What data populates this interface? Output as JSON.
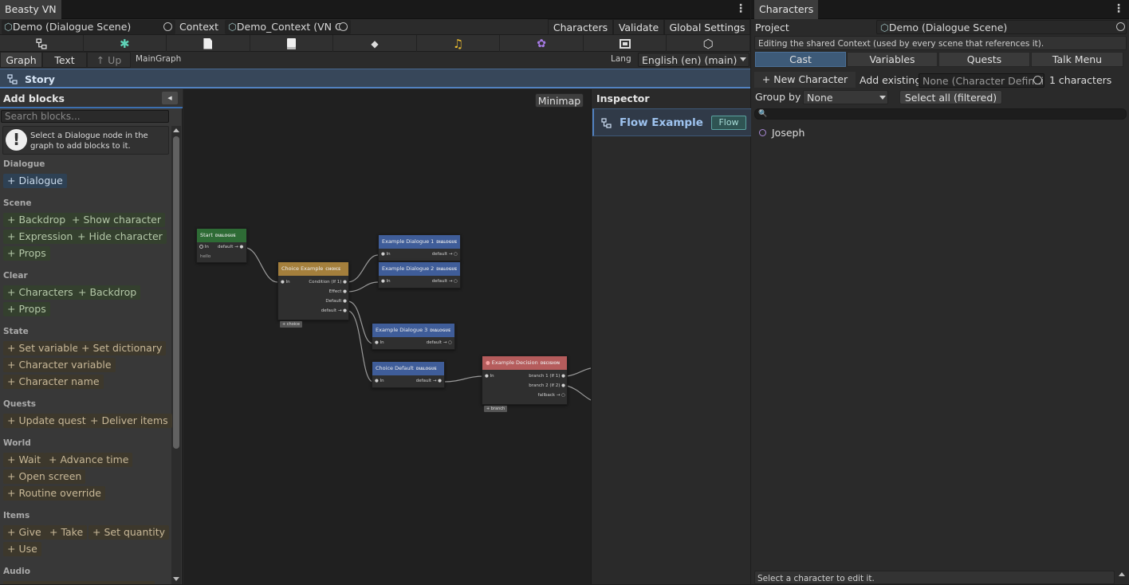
{
  "left_window": {
    "title": "Beasty VN",
    "scene_field": "Demo (Dialogue Scene)",
    "context_label": "Context",
    "context_field": "Demo_Context (VN Co",
    "top_buttons": [
      "Characters",
      "Validate",
      "Global Settings"
    ],
    "toolbar_icons": [
      "graph-icon",
      "character-figure-icon",
      "page-icon",
      "document-icon",
      "tag-icon",
      "music-note-icon",
      "network-icon",
      "frame-icon",
      "cube-icon"
    ],
    "view_tabs": {
      "graph": "Graph",
      "text": "Text",
      "up": "↑ Up"
    },
    "graph_name": "MainGraph",
    "lang_label": "Lang",
    "lang_value": "English (en) (main)",
    "breadcrumb": "Story"
  },
  "add_blocks": {
    "title": "Add blocks",
    "search_placeholder": "Search blocks...",
    "hint": "Select a Dialogue node in the graph to add blocks to it.",
    "sections": {
      "dialogue": {
        "title": "Dialogue",
        "items": [
          "+ Dialogue"
        ]
      },
      "scene": {
        "title": "Scene",
        "items": [
          "+ Backdrop",
          "+ Show character",
          "+ Expression",
          "+ Hide character",
          "+ Props"
        ]
      },
      "clear": {
        "title": "Clear",
        "items": [
          "+ Characters",
          "+ Backdrop",
          "+ Props"
        ]
      },
      "state": {
        "title": "State",
        "items": [
          "+ Set variable",
          "+ Set dictionary",
          "+ Character variable",
          "+ Character name"
        ]
      },
      "quests": {
        "title": "Quests",
        "items": [
          "+ Update quest",
          "+ Deliver items"
        ]
      },
      "world": {
        "title": "World",
        "items": [
          "+ Wait",
          "+ Advance time",
          "+ Open screen",
          "+ Routine override"
        ]
      },
      "items": {
        "title": "Items",
        "items": [
          "+ Give",
          "+ Take",
          "+ Set quantity",
          "+ Use"
        ]
      },
      "audio": {
        "title": "Audio"
      }
    }
  },
  "graph": {
    "minimap_button": "Minimap",
    "nodes": {
      "start": {
        "title": "Start",
        "tag": "DIALOGUE",
        "in": "In",
        "out": "default →",
        "text": "hello"
      },
      "choice": {
        "title": "Choice Example",
        "tag": "CHOICE",
        "in": "In",
        "ports": [
          "Condition (If 1)",
          "Effect",
          "Default",
          "default →"
        ],
        "button": "+ choice"
      },
      "d1": {
        "title": "Example Dialogue 1",
        "tag": "DIALOGUE",
        "in": "In",
        "out": "default →"
      },
      "d2": {
        "title": "Example Dialogue 2",
        "tag": "DIALOGUE",
        "in": "In",
        "out": "default →"
      },
      "d3": {
        "title": "Example Dialogue 3",
        "tag": "DIALOGUE",
        "in": "In",
        "out": "default →"
      },
      "cd": {
        "title": "Choice Default",
        "tag": "DIALOGUE",
        "in": "In",
        "out": "default →"
      },
      "decision": {
        "title": "Example Decision",
        "tag": "DECISION",
        "in": "In",
        "ports": [
          "branch 1 (If 1)",
          "branch 2 (If 2)",
          "fallback →"
        ],
        "button": "+ branch"
      }
    }
  },
  "inspector": {
    "title": "Inspector",
    "item": "Flow Example",
    "badge": "Flow"
  },
  "characters": {
    "title": "Characters",
    "project_label": "Project",
    "project_field": "Demo (Dialogue Scene)",
    "notice": "Editing the shared Context (used by every scene that references it).",
    "tabs": [
      "Cast",
      "Variables",
      "Quests",
      "Talk Menu"
    ],
    "new_character": "+ New Character",
    "add_existing_label": "Add existing",
    "add_existing_field": "None (Character Definiti",
    "count": "1 characters",
    "group_by_label": "Group by",
    "group_by_value": "None",
    "select_all": "Select all (filtered)",
    "list": [
      "Joseph"
    ],
    "status": "Select a character to edit it."
  }
}
